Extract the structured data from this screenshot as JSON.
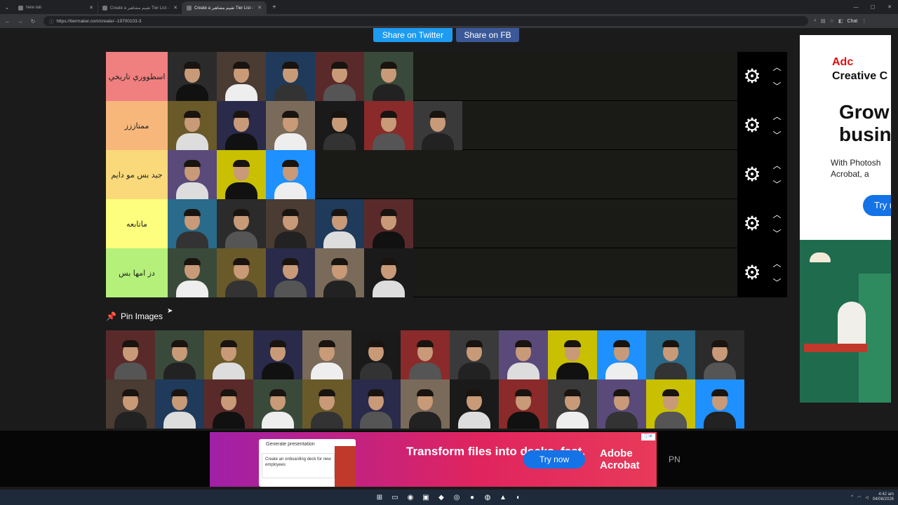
{
  "browser": {
    "tabs": [
      {
        "title": "New tab",
        "active": false
      },
      {
        "title": "Create a تقييم مشاهير Tier List - Ti",
        "active": false
      },
      {
        "title": "Create a تقييم مشاهير Tier List - Ti",
        "active": true
      }
    ],
    "url": "https://tiermaker.com/create/--19700103-3",
    "chat_label": "Chat"
  },
  "share": {
    "twitter": "Share on Twitter",
    "fb": "Share on FB"
  },
  "tiers": [
    {
      "label": "اسطووري تاريخي",
      "color": "#f07f7f",
      "count": 5
    },
    {
      "label": "ممتاززز",
      "color": "#f8b77a",
      "count": 6
    },
    {
      "label": "جيد بس مو دايم",
      "color": "#f9d97a",
      "count": 3
    },
    {
      "label": "ماتابعه",
      "color": "#fdfd7e",
      "count": 5
    },
    {
      "label": "دز امها بس",
      "color": "#b4f07a",
      "count": 5
    }
  ],
  "pin": {
    "label": "Pin Images"
  },
  "pool_count": 26,
  "side_ad": {
    "brand_line1": "Adc",
    "brand_line2": "Creative C",
    "headline": "Grow busin",
    "body": "With Photosh Acrobat, a",
    "cta": "Try n"
  },
  "bottom_ad": {
    "card_title": "Generate presentation",
    "card_body": "Create an onboarding deck for new employees",
    "headline": "Transform files into decks, fast.",
    "cta": "Try now",
    "brand": "Adobe Acrobat"
  },
  "bottom_right_text": "PN",
  "taskbar": {
    "time": "4:42 am",
    "date": "04/08/2026"
  }
}
